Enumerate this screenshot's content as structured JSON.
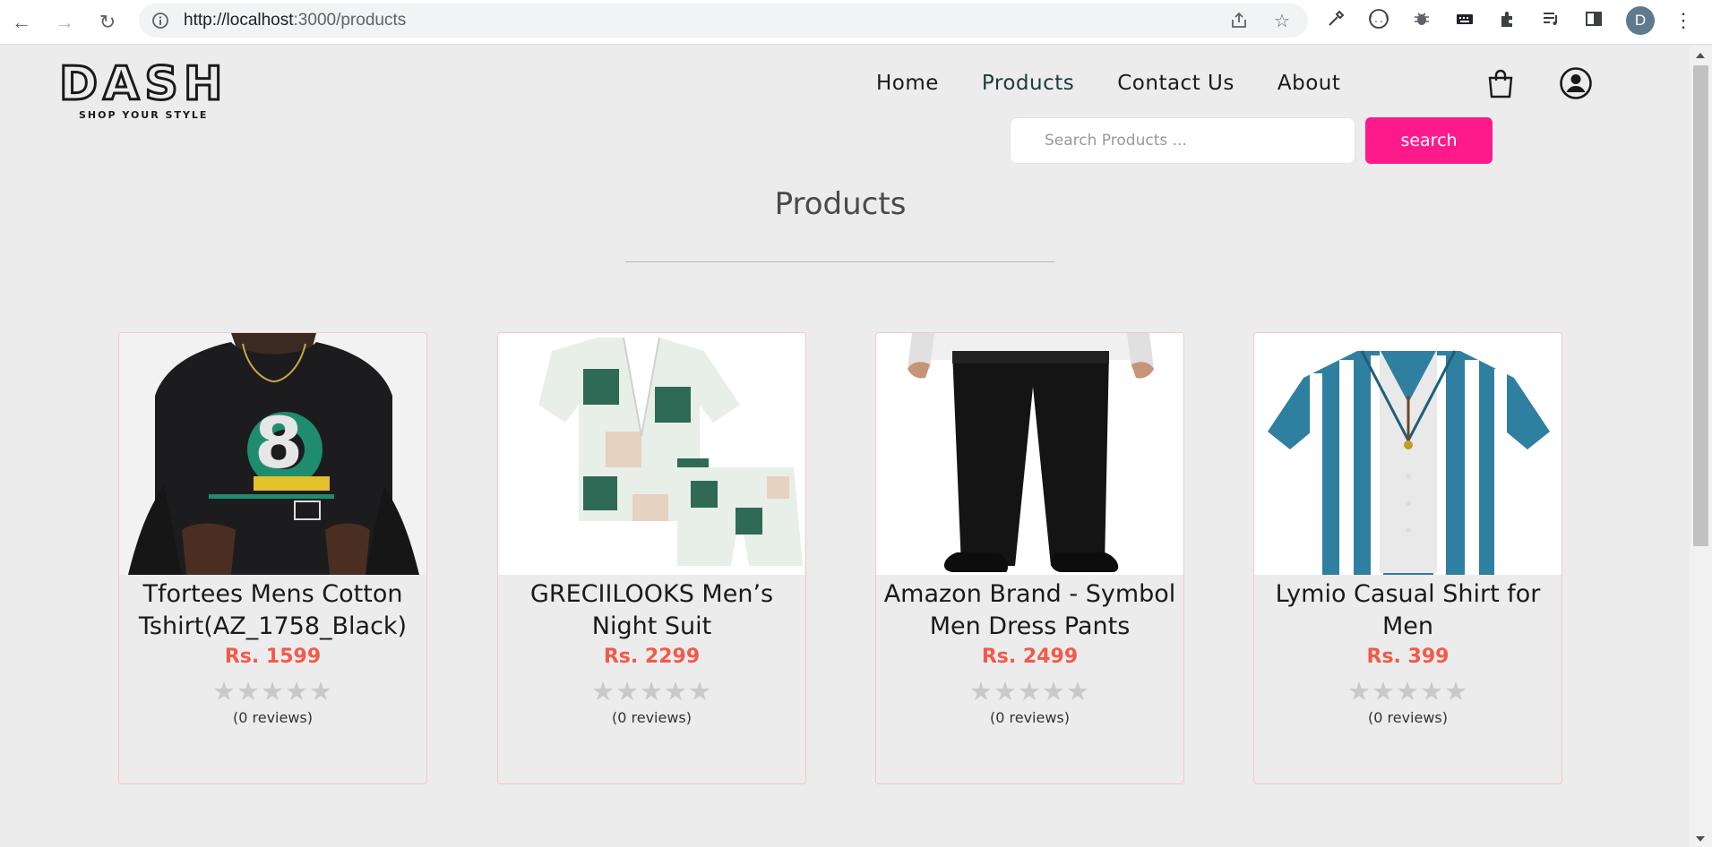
{
  "browser": {
    "url_host": "http://localhost",
    "url_path": ":3000/products",
    "profile_initial": "D"
  },
  "site": {
    "logo_text": "DASH",
    "logo_tagline": "SHOP YOUR STYLE",
    "nav": {
      "home": "Home",
      "products": "Products",
      "contact": "Contact Us",
      "about": "About"
    },
    "search": {
      "placeholder": "Search Products ...",
      "button": "search"
    }
  },
  "page": {
    "title": "Products"
  },
  "products": [
    {
      "name": "Tfortees Mens Cotton Tshirt(AZ_1758_Black)",
      "price": "Rs. 1599",
      "stars": "★★★★★",
      "reviews": "(0 reviews)"
    },
    {
      "name": "GRECIILOOKS Men’s Night Suit",
      "price": "Rs. 2299",
      "stars": "★★★★★",
      "reviews": "(0 reviews)"
    },
    {
      "name": "Amazon Brand - Symbol Men Dress Pants",
      "price": "Rs. 2499",
      "stars": "★★★★★",
      "reviews": "(0 reviews)"
    },
    {
      "name": "Lymio Casual Shirt for Men",
      "price": "Rs. 399",
      "stars": "★★★★★",
      "reviews": "(0 reviews)"
    }
  ],
  "colors": {
    "accent": "#ff1a8c",
    "price": "#f25a4a",
    "page_bg": "#ececec"
  }
}
